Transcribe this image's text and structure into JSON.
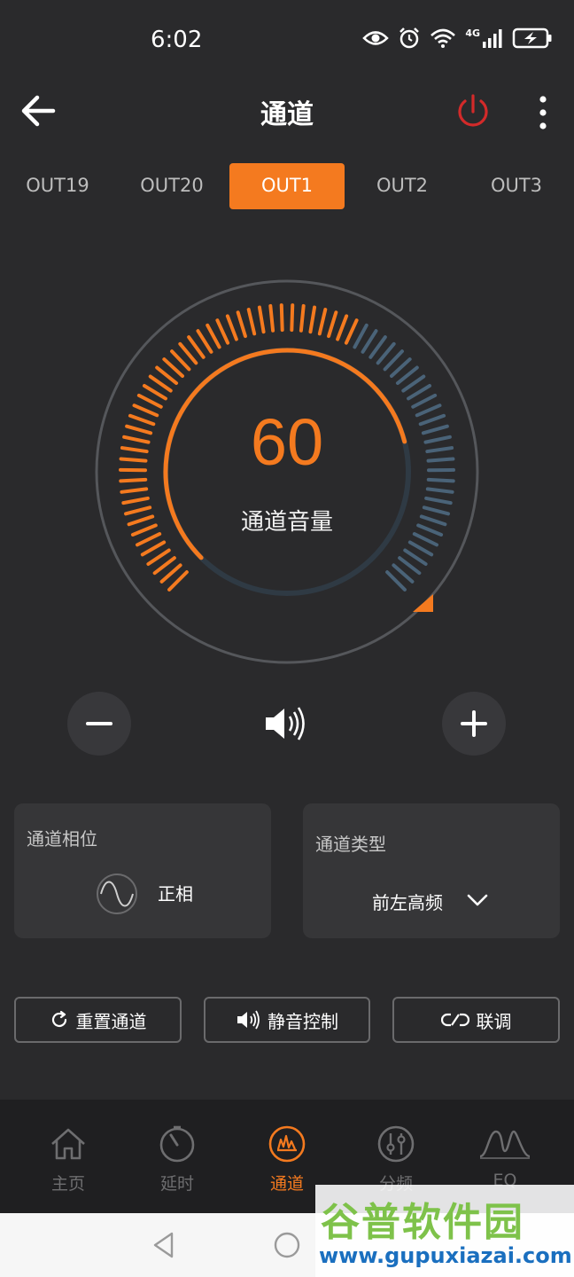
{
  "status_bar": {
    "time": "6:02",
    "network": "4G"
  },
  "header": {
    "title": "通道"
  },
  "tabs": [
    {
      "label": "OUT19",
      "active": false
    },
    {
      "label": "OUT20",
      "active": false
    },
    {
      "label": "OUT1",
      "active": true
    },
    {
      "label": "OUT2",
      "active": false
    },
    {
      "label": "OUT3",
      "active": false
    }
  ],
  "volume": {
    "value": "60",
    "label": "通道音量",
    "level_fraction": 0.6
  },
  "phase": {
    "title": "通道相位",
    "value": "正相",
    "icon": "sine-wave-icon"
  },
  "channel_type": {
    "title": "通道类型",
    "value": "前左高频"
  },
  "actions": {
    "reset": "重置通道",
    "mute": "静音控制",
    "link": "联调"
  },
  "bottom_nav": [
    {
      "label": "主页",
      "icon": "home-icon",
      "active": false
    },
    {
      "label": "延时",
      "icon": "timer-icon",
      "active": false
    },
    {
      "label": "通道",
      "icon": "channel-icon",
      "active": true
    },
    {
      "label": "分频",
      "icon": "crossover-icon",
      "active": false
    },
    {
      "label": "EQ",
      "icon": "eq-curve-icon",
      "active": false
    }
  ],
  "watermark": {
    "title": "谷普软件园",
    "url": "www.gupuxiazai.com"
  },
  "colors": {
    "accent": "#f47a1f",
    "background": "#2a2a2c",
    "card": "#363638",
    "inactive_tick": "#4a6378",
    "power": "#d32a2a"
  }
}
